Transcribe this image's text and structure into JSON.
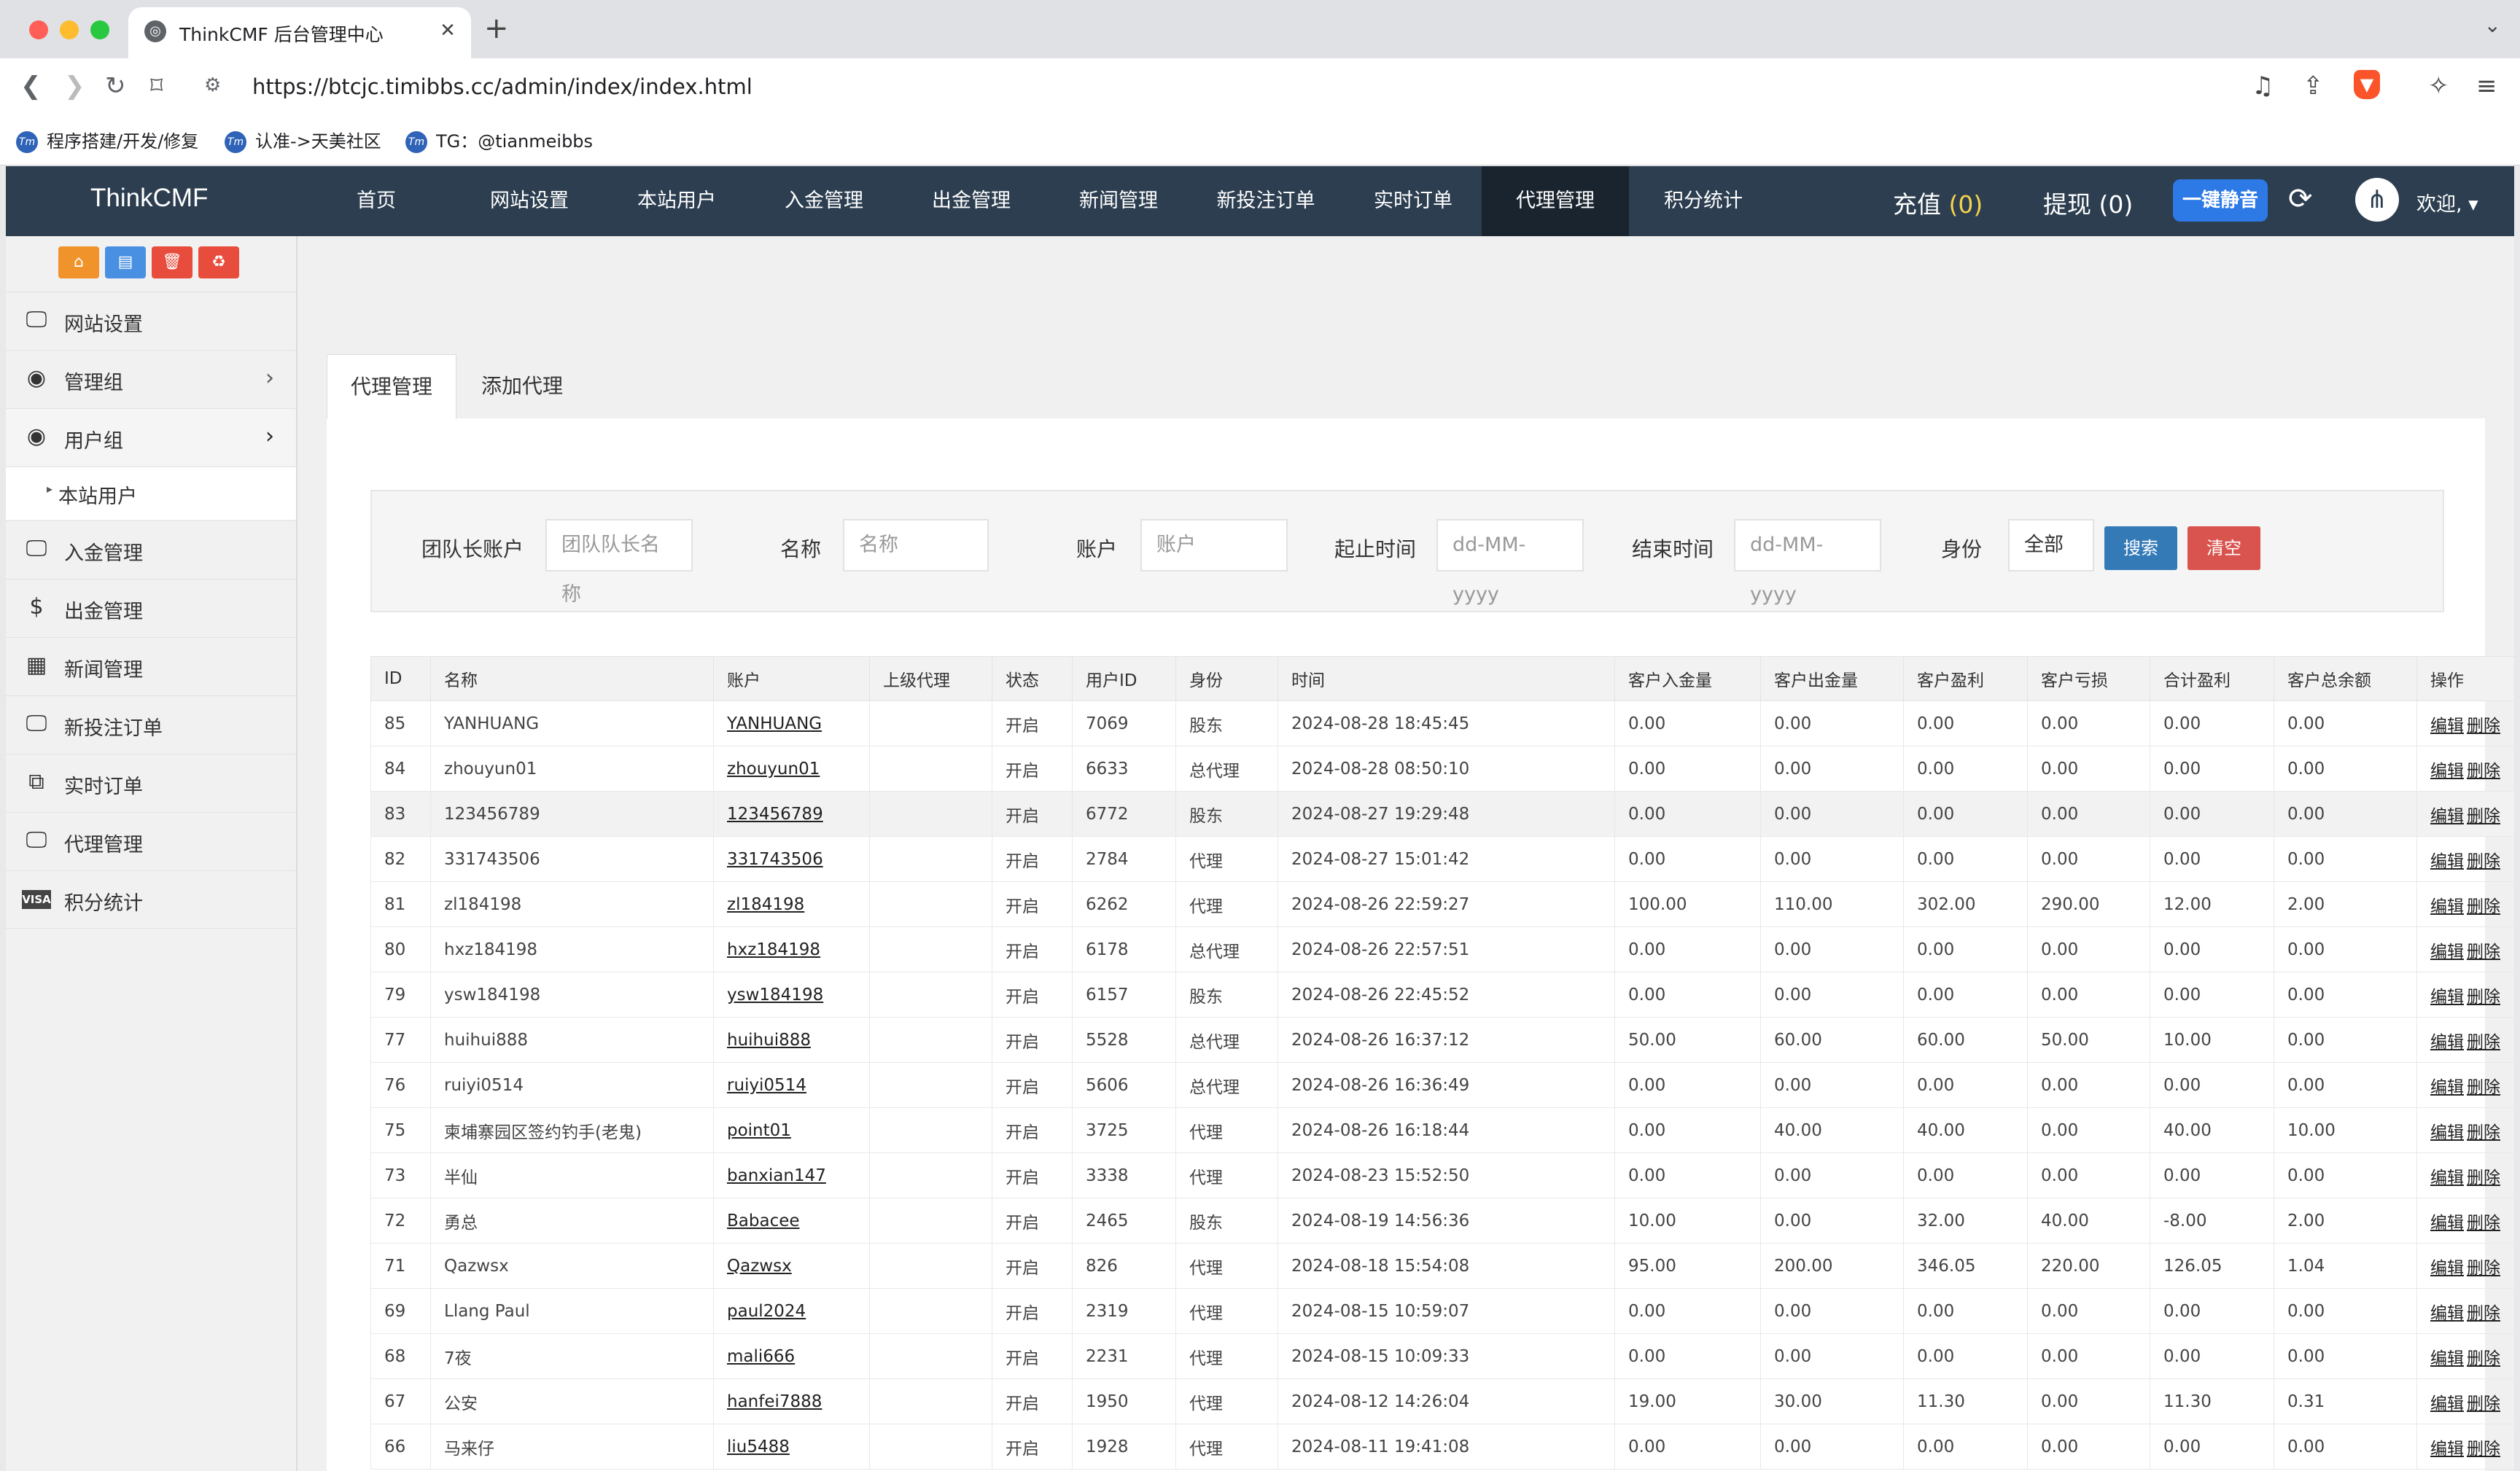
{
  "browser": {
    "tab_title": "ThinkCMF 后台管理中心",
    "url": "https://btcjc.timibbs.cc/admin/index/index.html",
    "bookmarks": [
      "程序搭建/开发/修复",
      "认准->天美社区",
      "TG：@tianmeibbs"
    ]
  },
  "header": {
    "brand": "ThinkCMF",
    "nav": [
      "首页",
      "网站设置",
      "本站用户",
      "入金管理",
      "出金管理",
      "新闻管理",
      "新投注订单",
      "实时订单",
      "代理管理",
      "积分统计"
    ],
    "active_nav": "代理管理",
    "recharge_label": "充值",
    "recharge_count": "(0)",
    "withdraw_label": "提现",
    "withdraw_count": "(0)",
    "mute_button": "一键静音",
    "welcome": "欢迎,"
  },
  "sidebar": {
    "items": [
      {
        "label": "网站设置",
        "icon": "monitor-icon"
      },
      {
        "label": "管理组",
        "icon": "user-circle-icon"
      },
      {
        "label": "用户组",
        "icon": "user-circle-icon"
      },
      {
        "label": "本站用户",
        "icon": "caret-right-icon"
      },
      {
        "label": "入金管理",
        "icon": "monitor-icon"
      },
      {
        "label": "出金管理",
        "icon": "dollar-icon"
      },
      {
        "label": "新闻管理",
        "icon": "newspaper-icon"
      },
      {
        "label": "新投注订单",
        "icon": "monitor-icon"
      },
      {
        "label": "实时订单",
        "icon": "window-restore-icon"
      },
      {
        "label": "代理管理",
        "icon": "monitor-icon"
      },
      {
        "label": "积分统计",
        "icon": "visa-icon"
      }
    ]
  },
  "tabs": [
    "代理管理",
    "添加代理"
  ],
  "filters": {
    "team_leader_label": "团队长账户",
    "team_leader_placeholder": "团队队长名称",
    "name_label": "名称",
    "name_placeholder": "名称",
    "account_label": "账户",
    "account_placeholder": "账户",
    "start_label": "起止时间",
    "start_placeholder": "dd-MM-yyyy",
    "end_label": "结束时间",
    "end_placeholder": "dd-MM-yyyy",
    "role_label": "身份",
    "role_value": "全部",
    "search_button": "搜索",
    "clear_button": "清空"
  },
  "table": {
    "columns": [
      "ID",
      "名称",
      "账户",
      "上级代理",
      "状态",
      "用户ID",
      "身份",
      "时间",
      "客户入金量",
      "客户出金量",
      "客户盈利",
      "客户亏损",
      "合计盈利",
      "客户总余额",
      "操作"
    ],
    "edit_label": "编辑",
    "delete_label": "删除",
    "rows": [
      [
        "85",
        "YANHUANG",
        "YANHUANG",
        "",
        "开启",
        "7069",
        "股东",
        "2024-08-28 18:45:45",
        "0.00",
        "0.00",
        "0.00",
        "0.00",
        "0.00",
        "0.00"
      ],
      [
        "84",
        "zhouyun01",
        "zhouyun01",
        "",
        "开启",
        "6633",
        "总代理",
        "2024-08-28 08:50:10",
        "0.00",
        "0.00",
        "0.00",
        "0.00",
        "0.00",
        "0.00"
      ],
      [
        "83",
        "123456789",
        "123456789",
        "",
        "开启",
        "6772",
        "股东",
        "2024-08-27 19:29:48",
        "0.00",
        "0.00",
        "0.00",
        "0.00",
        "0.00",
        "0.00"
      ],
      [
        "82",
        "331743506",
        "331743506",
        "",
        "开启",
        "2784",
        "代理",
        "2024-08-27 15:01:42",
        "0.00",
        "0.00",
        "0.00",
        "0.00",
        "0.00",
        "0.00"
      ],
      [
        "81",
        "zl184198",
        "zl184198",
        "",
        "开启",
        "6262",
        "代理",
        "2024-08-26 22:59:27",
        "100.00",
        "110.00",
        "302.00",
        "290.00",
        "12.00",
        "2.00"
      ],
      [
        "80",
        "hxz184198",
        "hxz184198",
        "",
        "开启",
        "6178",
        "总代理",
        "2024-08-26 22:57:51",
        "0.00",
        "0.00",
        "0.00",
        "0.00",
        "0.00",
        "0.00"
      ],
      [
        "79",
        "ysw184198",
        "ysw184198",
        "",
        "开启",
        "6157",
        "股东",
        "2024-08-26 22:45:52",
        "0.00",
        "0.00",
        "0.00",
        "0.00",
        "0.00",
        "0.00"
      ],
      [
        "77",
        "huihui888",
        "huihui888",
        "",
        "开启",
        "5528",
        "总代理",
        "2024-08-26 16:37:12",
        "50.00",
        "60.00",
        "60.00",
        "50.00",
        "10.00",
        "0.00"
      ],
      [
        "76",
        "ruiyi0514",
        "ruiyi0514",
        "",
        "开启",
        "5606",
        "总代理",
        "2024-08-26 16:36:49",
        "0.00",
        "0.00",
        "0.00",
        "0.00",
        "0.00",
        "0.00"
      ],
      [
        "75",
        "柬埔寨园区签约钓手(老鬼)",
        "point01",
        "",
        "开启",
        "3725",
        "代理",
        "2024-08-26 16:18:44",
        "0.00",
        "40.00",
        "40.00",
        "0.00",
        "40.00",
        "10.00"
      ],
      [
        "73",
        "半仙",
        "banxian147",
        "",
        "开启",
        "3338",
        "代理",
        "2024-08-23 15:52:50",
        "0.00",
        "0.00",
        "0.00",
        "0.00",
        "0.00",
        "0.00"
      ],
      [
        "72",
        "勇总",
        "Babacee",
        "",
        "开启",
        "2465",
        "股东",
        "2024-08-19 14:56:36",
        "10.00",
        "0.00",
        "32.00",
        "40.00",
        "-8.00",
        "2.00"
      ],
      [
        "71",
        "Qazwsx",
        "Qazwsx",
        "",
        "开启",
        "826",
        "代理",
        "2024-08-18 15:54:08",
        "95.00",
        "200.00",
        "346.05",
        "220.00",
        "126.05",
        "1.04"
      ],
      [
        "69",
        "Llang Paul",
        "paul2024",
        "",
        "开启",
        "2319",
        "代理",
        "2024-08-15 10:59:07",
        "0.00",
        "0.00",
        "0.00",
        "0.00",
        "0.00",
        "0.00"
      ],
      [
        "68",
        "7夜",
        "mali666",
        "",
        "开启",
        "2231",
        "代理",
        "2024-08-15 10:09:33",
        "0.00",
        "0.00",
        "0.00",
        "0.00",
        "0.00",
        "0.00"
      ],
      [
        "67",
        "公安",
        "hanfei7888",
        "",
        "开启",
        "1950",
        "代理",
        "2024-08-12 14:26:04",
        "19.00",
        "30.00",
        "11.30",
        "0.00",
        "11.30",
        "0.31"
      ],
      [
        "66",
        "马来仔",
        "liu5488",
        "",
        "开启",
        "1928",
        "代理",
        "2024-08-11 19:41:08",
        "0.00",
        "0.00",
        "0.00",
        "0.00",
        "0.00",
        "0.00"
      ]
    ]
  }
}
